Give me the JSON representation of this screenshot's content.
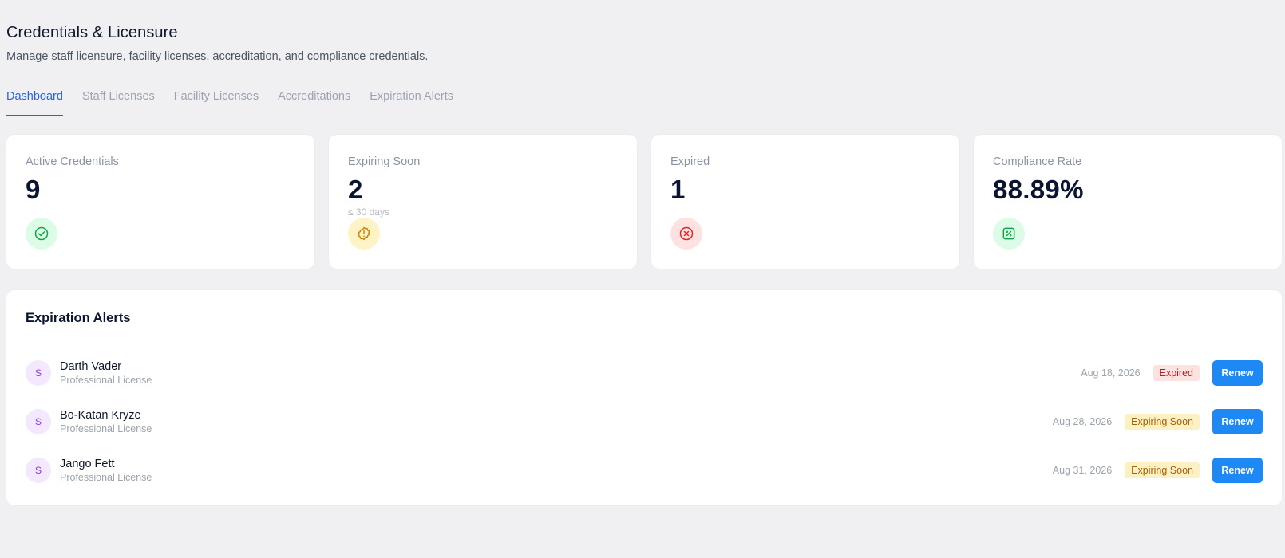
{
  "header": {
    "title": "Credentials & Licensure",
    "subtitle": "Manage staff licensure, facility licenses, accreditation, and compliance credentials."
  },
  "tabs": [
    {
      "label": "Dashboard",
      "active": true
    },
    {
      "label": "Staff Licenses",
      "active": false
    },
    {
      "label": "Facility Licenses",
      "active": false
    },
    {
      "label": "Accreditations",
      "active": false
    },
    {
      "label": "Expiration Alerts",
      "active": false
    }
  ],
  "stats": [
    {
      "label": "Active Credentials",
      "value": "9",
      "sub": "",
      "icon": "check-circle-icon",
      "color": "#16a34a",
      "bg": "#dcfce7"
    },
    {
      "label": "Expiring Soon",
      "value": "2",
      "sub": "≤ 30 days",
      "icon": "alert-badge-icon",
      "color": "#ca8a04",
      "bg": "#fef3c7"
    },
    {
      "label": "Expired",
      "value": "1",
      "sub": "",
      "icon": "x-circle-icon",
      "color": "#dc2626",
      "bg": "#fee2e2"
    },
    {
      "label": "Compliance Rate",
      "value": "88.89%",
      "sub": "",
      "icon": "percent-square-icon",
      "color": "#16a34a",
      "bg": "#dcfce7"
    }
  ],
  "alerts": {
    "title": "Expiration Alerts",
    "items": [
      {
        "initial": "S",
        "name": "Darth Vader",
        "type": "Professional License",
        "date": "Aug 18, 2026",
        "status": "Expired",
        "status_kind": "expired",
        "action": "Renew"
      },
      {
        "initial": "S",
        "name": "Bo-Katan Kryze",
        "type": "Professional License",
        "date": "Aug 28, 2026",
        "status": "Expiring Soon",
        "status_kind": "soon",
        "action": "Renew"
      },
      {
        "initial": "S",
        "name": "Jango Fett",
        "type": "Professional License",
        "date": "Aug 31, 2026",
        "status": "Expiring Soon",
        "status_kind": "soon",
        "action": "Renew"
      }
    ]
  },
  "colors": {
    "accent": "#2563eb",
    "button": "#1e88f5",
    "background": "#f0f0f3"
  }
}
